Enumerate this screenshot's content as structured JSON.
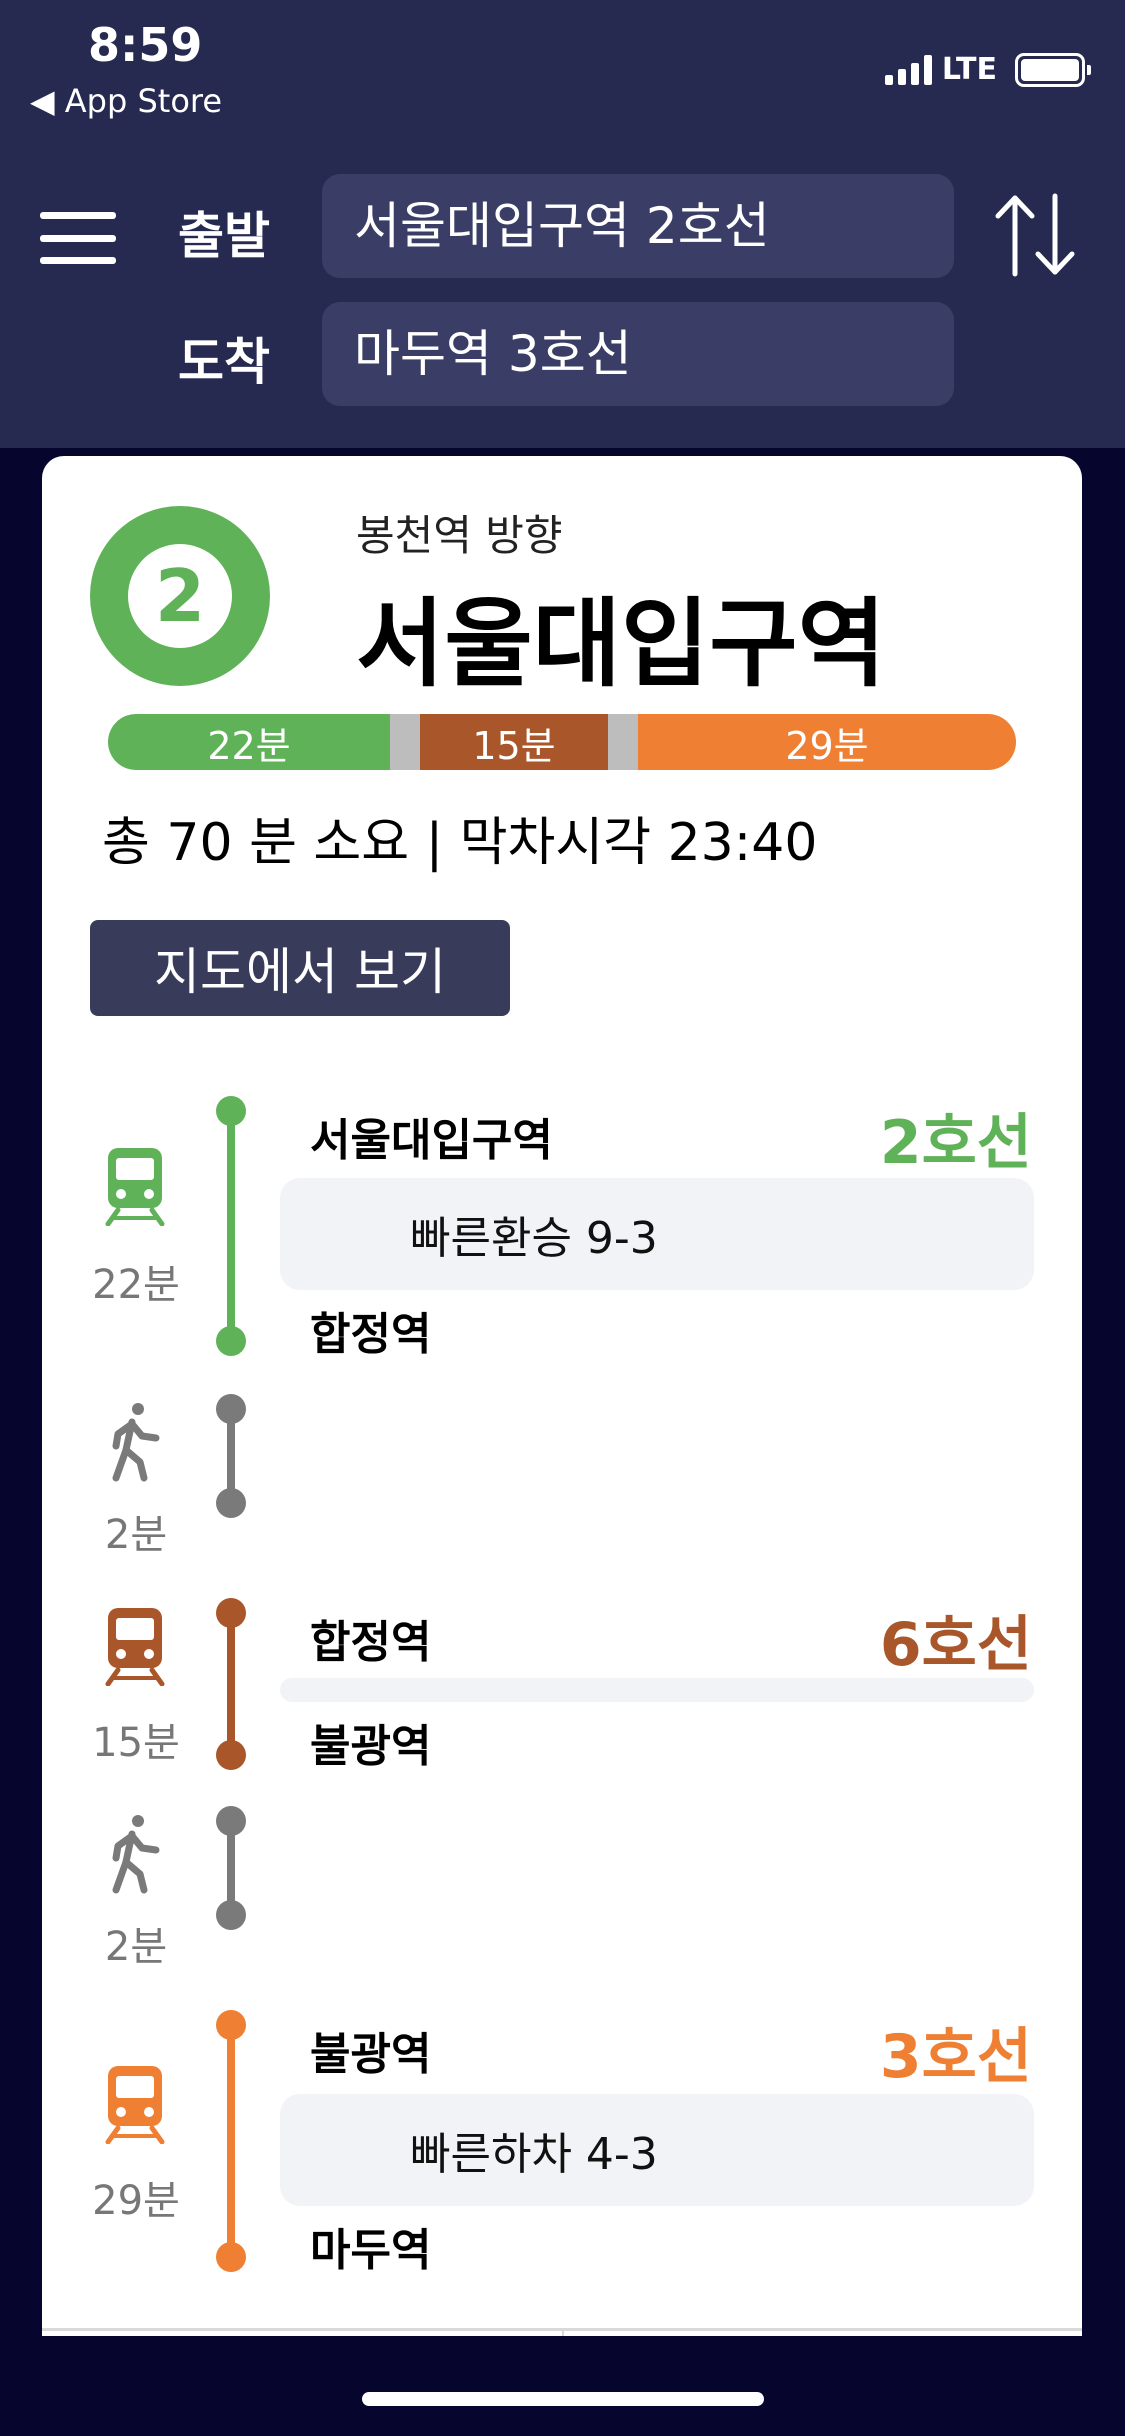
{
  "status_bar": {
    "time": "8:59",
    "back_label": "◀ App Store",
    "network": "LTE"
  },
  "header": {
    "from_label": "출발",
    "from_value": "서울대입구역 2호선",
    "to_label": "도착",
    "to_value": "마두역 3호선"
  },
  "card": {
    "line_number": "2",
    "line_color": "#5fb257",
    "direction": "봉천역 방향",
    "station": "서울대입구역",
    "segments": [
      {
        "label": "22분",
        "color": "#5fb257"
      },
      {
        "label": "15분",
        "color": "#a8562a"
      },
      {
        "label": "29분",
        "color": "#ee7f33"
      }
    ],
    "gap_color": "#bdbdbd",
    "summary": "총 70 분 소요 | 막차시각 23:40",
    "map_button": "지도에서 보기"
  },
  "timeline": [
    {
      "kind": "train",
      "color": "#5fb257",
      "duration": "22분",
      "from": "서울대입구역",
      "to": "합정역",
      "line": "2호선",
      "info": "빠른환승 9-3"
    },
    {
      "kind": "walk",
      "color": "#7a7a7a",
      "duration": "2분"
    },
    {
      "kind": "train",
      "color": "#a8562a",
      "duration": "15분",
      "from": "합정역",
      "to": "불광역",
      "line": "6호선",
      "info": ""
    },
    {
      "kind": "walk",
      "color": "#7a7a7a",
      "duration": "2분"
    },
    {
      "kind": "train",
      "color": "#ee7f33",
      "duration": "29분",
      "from": "불광역",
      "to": "마두역",
      "line": "3호선",
      "info": "빠른하차 4-3"
    }
  ]
}
